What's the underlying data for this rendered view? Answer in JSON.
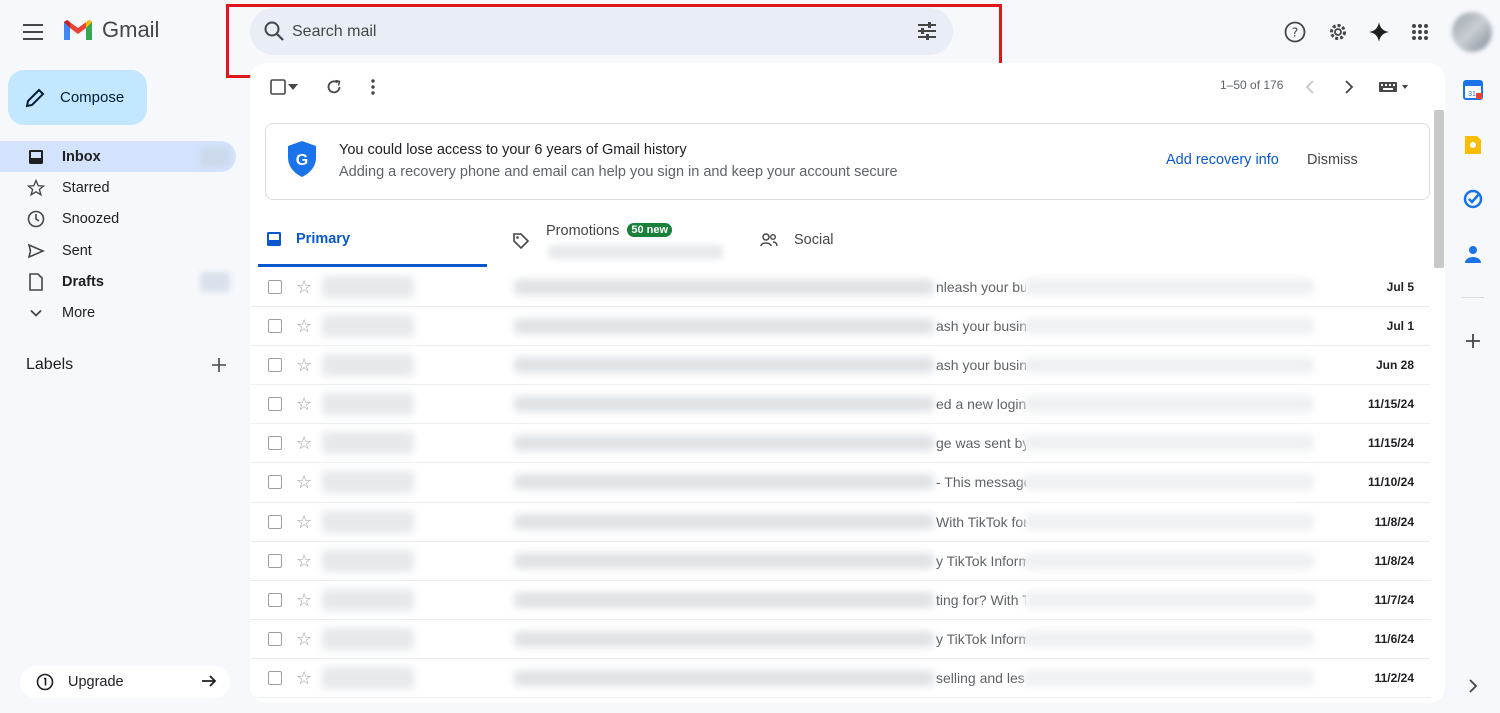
{
  "app": {
    "name": "Gmail"
  },
  "search": {
    "placeholder": "Search mail"
  },
  "sidebar": {
    "compose": "Compose",
    "items": [
      {
        "label": "Inbox",
        "icon": "inbox-icon"
      },
      {
        "label": "Starred",
        "icon": "star-icon"
      },
      {
        "label": "Snoozed",
        "icon": "clock-icon"
      },
      {
        "label": "Sent",
        "icon": "send-icon"
      },
      {
        "label": "Drafts",
        "icon": "draft-icon"
      },
      {
        "label": "More",
        "icon": "chevron-down-icon"
      }
    ],
    "labels_title": "Labels",
    "upgrade": "Upgrade"
  },
  "toolbar": {
    "pager": "1–50 of 176"
  },
  "banner": {
    "title": "You could lose access to your 6 years of Gmail history",
    "subtitle": "Adding a recovery phone and email can help you sign in and keep your account secure",
    "action": "Add recovery info",
    "dismiss": "Dismiss"
  },
  "tabs": [
    {
      "label": "Primary"
    },
    {
      "label": "Promotions",
      "badge": "50 new"
    },
    {
      "label": "Social"
    }
  ],
  "emails": [
    {
      "snippet": "nleash your bu",
      "date": "Jul 5"
    },
    {
      "snippet": "ash your busine",
      "date": "Jul 1"
    },
    {
      "snippet": "ash your busine",
      "date": "Jun 28"
    },
    {
      "snippet": "ed a new login",
      "date": "11/15/24"
    },
    {
      "snippet": "ge was sent by",
      "date": "11/15/24"
    },
    {
      "snippet": "- This message",
      "date": "11/10/24"
    },
    {
      "snippet": "With TikTok for S",
      "date": "11/8/24"
    },
    {
      "snippet": "y TikTok Inform",
      "date": "11/8/24"
    },
    {
      "snippet": "ting for? With T",
      "date": "11/7/24"
    },
    {
      "snippet": "y TikTok Inform",
      "date": "11/6/24"
    },
    {
      "snippet": "selling and les",
      "date": "11/2/24"
    }
  ],
  "colors": {
    "accent": "#0b57d0",
    "compose_bg": "#c2e7ff",
    "active_nav": "#d3e3fd",
    "badge": "#188038",
    "highlight": "#e0161b"
  }
}
